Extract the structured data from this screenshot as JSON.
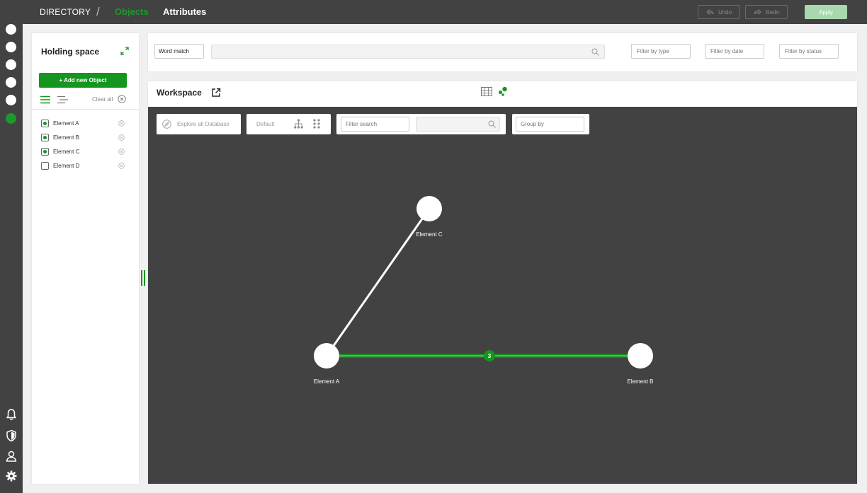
{
  "colors": {
    "accent": "#14961f",
    "dark_bg": "#424242",
    "apply_disabled": "#a9d8ae"
  },
  "header": {
    "brand": "DIRECTORY",
    "separator": "/",
    "tabs": [
      {
        "label": "Objects",
        "active": true
      },
      {
        "label": "Attributes",
        "active": false
      }
    ],
    "undo_label": "Undo",
    "redo_label": "Redo",
    "apply_label": "Apply"
  },
  "rail": {
    "items": [
      {
        "icon": "circle",
        "active": false
      },
      {
        "icon": "circle",
        "active": false
      },
      {
        "icon": "circle",
        "active": false
      },
      {
        "icon": "circle",
        "active": false
      },
      {
        "icon": "circle",
        "active": false
      },
      {
        "icon": "circle",
        "active": true
      }
    ],
    "bottom_icons": [
      "bell-icon",
      "shield-icon",
      "user-icon",
      "gear-icon"
    ]
  },
  "holding_space": {
    "title": "Holding space",
    "add_button": "+ Add new Object",
    "clear_all": "Clear all",
    "elements": [
      {
        "label": "Element A",
        "checked": true
      },
      {
        "label": "Element B",
        "checked": true
      },
      {
        "label": "Element C",
        "checked": true
      },
      {
        "label": "Element D",
        "checked": false
      }
    ]
  },
  "search": {
    "word_match": "Word match",
    "query": "",
    "filter_type_placeholder": "Filter by type",
    "filter_date_placeholder": "Filter by date",
    "filter_status_placeholder": "Filter by status"
  },
  "workspace": {
    "title": "Workspace",
    "explore_label": "Explore all Database",
    "layout_label": "Default",
    "filter_search_placeholder": "Filter search",
    "group_by_placeholder": "Group by",
    "graph": {
      "nodes": [
        {
          "id": "A",
          "label": "Element A"
        },
        {
          "id": "B",
          "label": "Element B"
        },
        {
          "id": "C",
          "label": "Element C"
        }
      ],
      "edges": [
        {
          "from": "A",
          "to": "C",
          "highlighted": false
        },
        {
          "from": "A",
          "to": "B",
          "highlighted": true,
          "count": "3"
        }
      ]
    }
  }
}
